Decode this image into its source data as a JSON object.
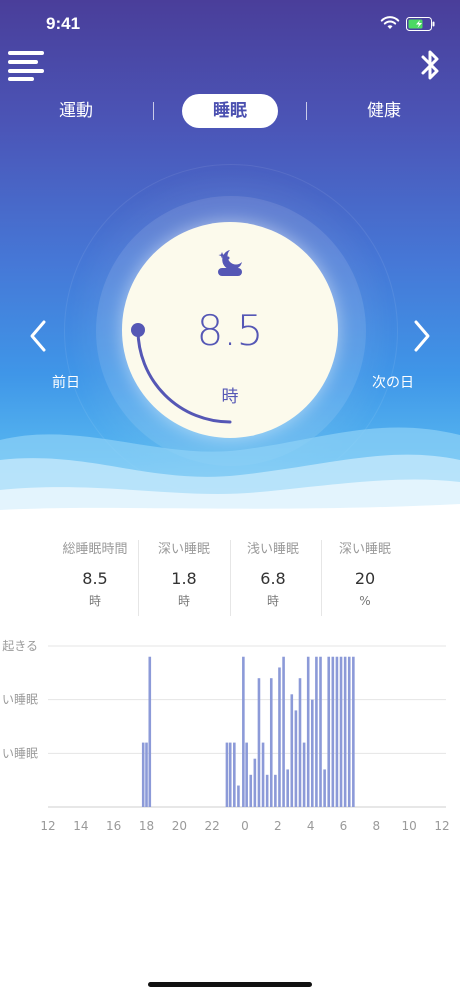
{
  "status_bar": {
    "time": "9:41"
  },
  "tabs": [
    {
      "label": "運動"
    },
    {
      "label": "睡眠",
      "active": true
    },
    {
      "label": "健康"
    }
  ],
  "dial": {
    "value": "8.5",
    "unit": "時",
    "progress": 0.25,
    "icon": "moon-stars-icon"
  },
  "nav": {
    "prev_label": "前日",
    "next_label": "次の日"
  },
  "stats": [
    {
      "label": "総睡眠時間",
      "value": "8.5",
      "unit": "時"
    },
    {
      "label": "深い睡眠",
      "value": "1.8",
      "unit": "時"
    },
    {
      "label": "浅い睡眠",
      "value": "6.8",
      "unit": "時"
    },
    {
      "label": "深い睡眠",
      "value": "20",
      "unit": "%"
    }
  ],
  "colors": {
    "accent": "#5557b5",
    "bar": "#8c9ad8",
    "dial_bg": "#fcfaec"
  },
  "chart_data": {
    "type": "bar",
    "y_levels": [
      {
        "label": "起きる",
        "value": 3
      },
      {
        "label": "い睡眠",
        "value": 2
      },
      {
        "label": "い睡眠",
        "value": 1
      }
    ],
    "x_ticks": [
      "12",
      "14",
      "16",
      "18",
      "20",
      "22",
      "0",
      "2",
      "4",
      "6",
      "8",
      "10",
      "12"
    ],
    "xlim": [
      12,
      36
    ],
    "ylim": [
      0,
      3
    ],
    "grid": true,
    "bars": [
      {
        "x": 17.8,
        "value": 1.2
      },
      {
        "x": 18.0,
        "value": 1.2
      },
      {
        "x": 18.2,
        "value": 2.8
      },
      {
        "x": 22.9,
        "value": 1.2
      },
      {
        "x": 23.1,
        "value": 1.2
      },
      {
        "x": 23.35,
        "value": 1.2
      },
      {
        "x": 23.6,
        "value": 0.4
      },
      {
        "x": 23.9,
        "value": 2.8
      },
      {
        "x": 24.1,
        "value": 1.2
      },
      {
        "x": 24.35,
        "value": 0.6
      },
      {
        "x": 24.6,
        "value": 0.9
      },
      {
        "x": 24.85,
        "value": 2.4
      },
      {
        "x": 25.1,
        "value": 1.2
      },
      {
        "x": 25.35,
        "value": 0.6
      },
      {
        "x": 25.6,
        "value": 2.4
      },
      {
        "x": 25.85,
        "value": 0.6
      },
      {
        "x": 26.1,
        "value": 2.6
      },
      {
        "x": 26.35,
        "value": 2.8
      },
      {
        "x": 26.6,
        "value": 0.7
      },
      {
        "x": 26.85,
        "value": 2.1
      },
      {
        "x": 27.1,
        "value": 1.8
      },
      {
        "x": 27.35,
        "value": 2.4
      },
      {
        "x": 27.6,
        "value": 1.2
      },
      {
        "x": 27.85,
        "value": 2.8
      },
      {
        "x": 28.1,
        "value": 2.0
      },
      {
        "x": 28.35,
        "value": 2.8
      },
      {
        "x": 28.6,
        "value": 2.8
      },
      {
        "x": 28.85,
        "value": 0.7
      },
      {
        "x": 29.1,
        "value": 2.8
      },
      {
        "x": 29.35,
        "value": 2.8
      },
      {
        "x": 29.6,
        "value": 2.8
      },
      {
        "x": 29.85,
        "value": 2.8
      },
      {
        "x": 30.1,
        "value": 2.8
      },
      {
        "x": 30.35,
        "value": 2.8
      },
      {
        "x": 30.6,
        "value": 2.8
      }
    ]
  }
}
